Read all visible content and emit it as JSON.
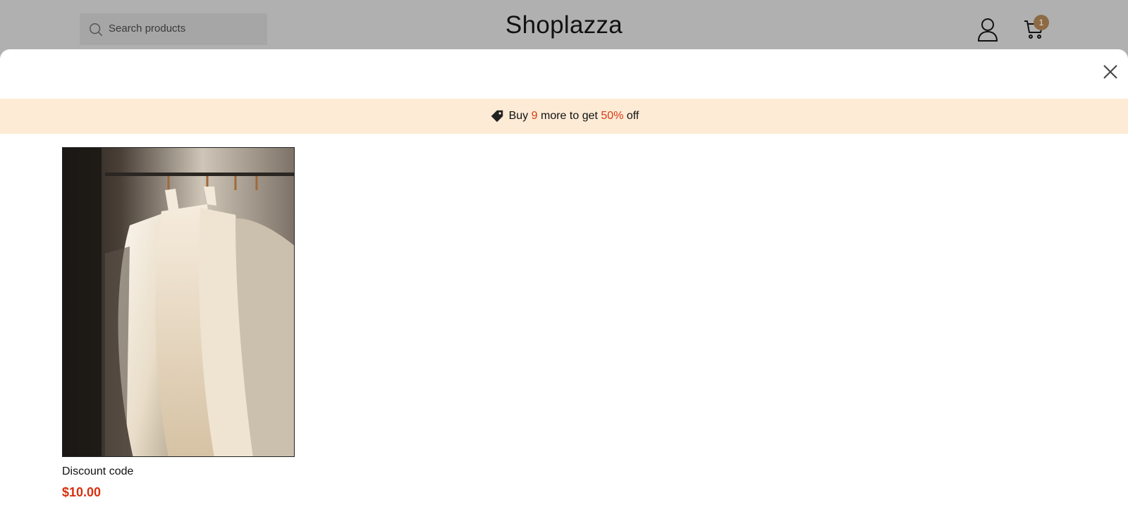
{
  "header": {
    "search_placeholder": "Search products",
    "brand": "Shoplazza",
    "cart_count": "1"
  },
  "promo": {
    "prefix": "Buy",
    "count": "9",
    "middle": "more to get",
    "percent": "50%",
    "suffix": "off",
    "accent_color": "#d83a16",
    "background_color": "#fdebd5"
  },
  "products": [
    {
      "title": "Discount code",
      "price": "$10.00",
      "image": "white-dresses-on-hangers"
    }
  ],
  "icons": {
    "search": "search-icon",
    "account": "account-icon",
    "cart": "cart-icon",
    "close": "close-icon",
    "tag": "tag-icon"
  },
  "colors": {
    "price": "#d8300f",
    "badge": "#8c6a45",
    "overlay": "#b0b0b0"
  }
}
